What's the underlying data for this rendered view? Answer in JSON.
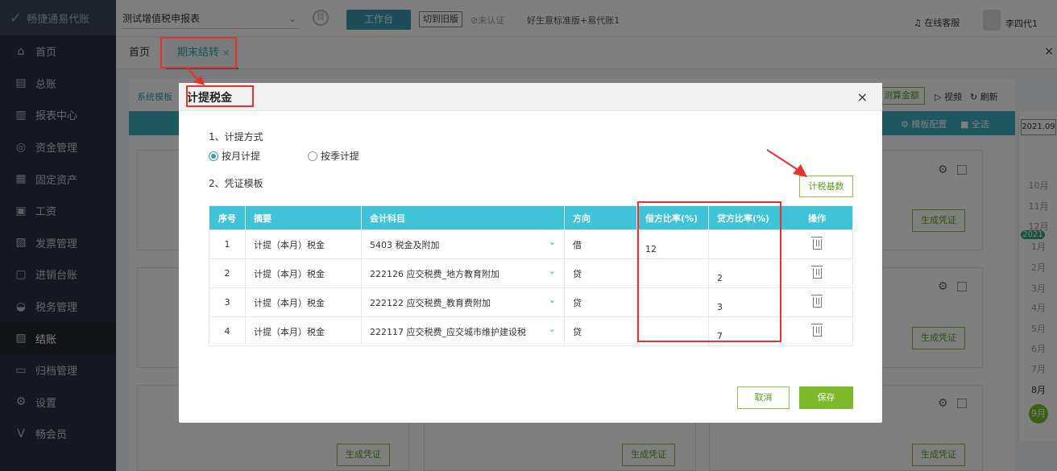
{
  "sidebar": {
    "logo": "畅捷通易代账",
    "items": [
      {
        "label": "首页",
        "icon": "home-icon",
        "glyph": "⌂"
      },
      {
        "label": "总账",
        "icon": "ledger-icon",
        "glyph": "▤"
      },
      {
        "label": "报表中心",
        "icon": "chart-icon",
        "glyph": "▥"
      },
      {
        "label": "资金管理",
        "icon": "money-icon",
        "glyph": "◎"
      },
      {
        "label": "固定资产",
        "icon": "asset-icon",
        "glyph": "▦"
      },
      {
        "label": "工资",
        "icon": "salary-icon",
        "glyph": "▣"
      },
      {
        "label": "发票管理",
        "icon": "invoice-icon",
        "glyph": "▧"
      },
      {
        "label": "进销台账",
        "icon": "stock-icon",
        "glyph": "▢"
      },
      {
        "label": "税务管理",
        "icon": "tax-icon",
        "glyph": "◒"
      },
      {
        "label": "结账",
        "icon": "closing-icon",
        "glyph": "▨"
      },
      {
        "label": "归档管理",
        "icon": "archive-icon",
        "glyph": "▭"
      },
      {
        "label": "设置",
        "icon": "settings-icon",
        "glyph": "⚙"
      },
      {
        "label": "畅会员",
        "icon": "member-icon",
        "glyph": "V"
      }
    ]
  },
  "topbar": {
    "company": "测试增值税申报表",
    "workbench": "工作台",
    "switch_old": "切到旧版",
    "unverified": "未认证",
    "product": "好生意标准版+易代账1",
    "service": "在线客服",
    "user": "李四代1"
  },
  "tabs": {
    "home": "首页",
    "period": "期末结转"
  },
  "background": {
    "gen_button": "生成凭证",
    "months": [
      "10月",
      "11月",
      "12月",
      "1月",
      "2月",
      "3月",
      "4月",
      "5月",
      "6月",
      "7月",
      "8月",
      "9月"
    ],
    "year": "2021.09",
    "year_badge": "2021",
    "actions": {
      "template": "系统模板",
      "calc": "测算金额",
      "video": "视频",
      "refresh": "刷新",
      "config": "模板配置",
      "select_all": "全选"
    }
  },
  "modal": {
    "title": "计提税金",
    "section1": "1、计提方式",
    "radio_monthly": "按月计提",
    "radio_quarterly": "按季计提",
    "section2": "2、凭证模板",
    "base_button": "计税基数",
    "columns": [
      "序号",
      "摘要",
      "会计科目",
      "方向",
      "借方比率(%)",
      "贷方比率(%)",
      "操作"
    ],
    "rows": [
      {
        "no": "1",
        "summary": "计提（本月）税金",
        "account": "5403  税金及附加",
        "dir": "借",
        "debit": "12",
        "credit": ""
      },
      {
        "no": "2",
        "summary": "计提（本月）税金",
        "account": "222126  应交税费_地方教育附加",
        "dir": "贷",
        "debit": "",
        "credit": "2"
      },
      {
        "no": "3",
        "summary": "计提（本月）税金",
        "account": "222122  应交税费_教育费附加",
        "dir": "贷",
        "debit": "",
        "credit": "3"
      },
      {
        "no": "4",
        "summary": "计提（本月）税金",
        "account": "222117  应交税费_应交城市维护建设税",
        "dir": "贷",
        "debit": "",
        "credit": "7"
      }
    ],
    "cancel": "取消",
    "save": "保存"
  }
}
